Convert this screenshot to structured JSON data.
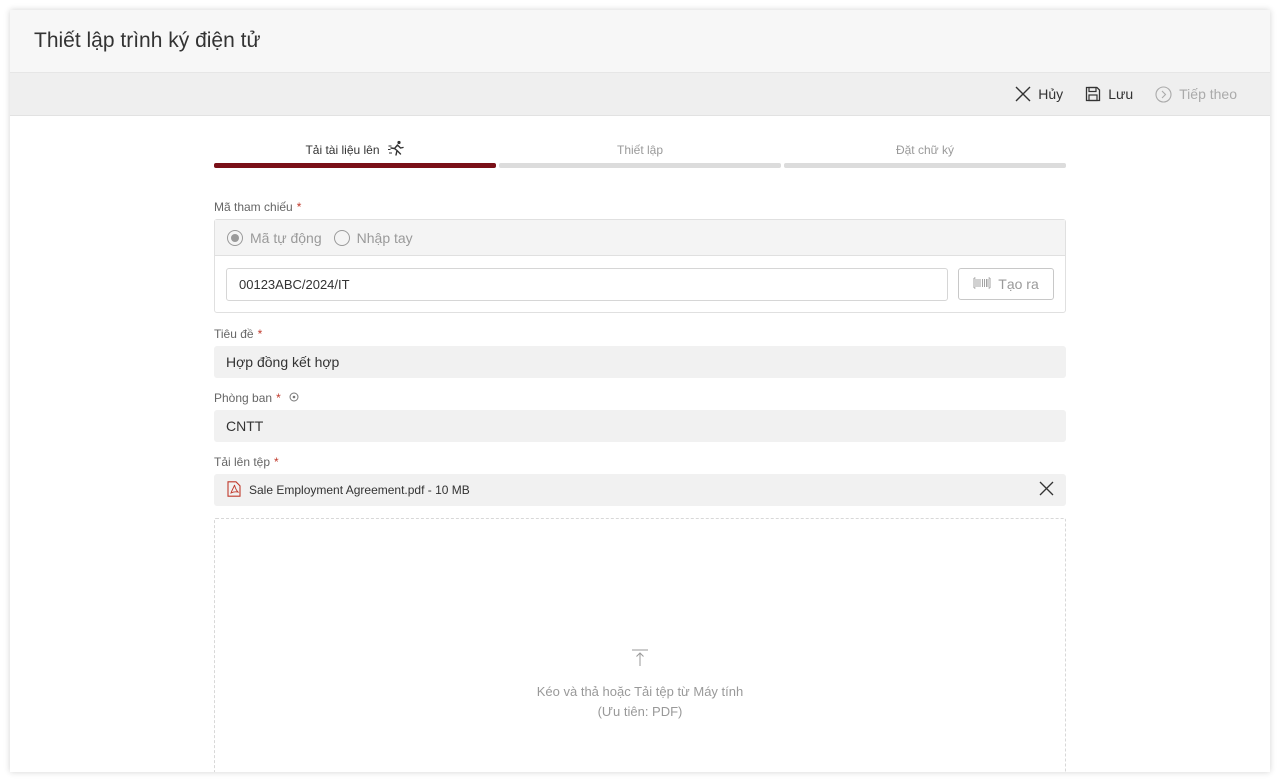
{
  "window": {
    "title": "Thiết lập trình ký điện tử"
  },
  "toolbar": {
    "cancel_label": "Hủy",
    "save_label": "Lưu",
    "next_label": "Tiếp theo"
  },
  "steps": [
    {
      "label": "Tải tài liệu lên",
      "state": "active"
    },
    {
      "label": "Thiết lập",
      "state": "inactive"
    },
    {
      "label": "Đặt chữ ký",
      "state": "inactive"
    }
  ],
  "reference": {
    "label": "Mã tham chiếu",
    "required_mark": "*",
    "option_auto": "Mã tự động",
    "option_manual": "Nhập tay",
    "value": "00123ABC/2024/IT",
    "generate_label": "Tạo ra"
  },
  "title_field": {
    "label": "Tiêu đề",
    "required_mark": "*",
    "value": "Hợp đồng kết hợp"
  },
  "department": {
    "label": "Phòng ban",
    "required_mark": "*",
    "value": "CNTT"
  },
  "upload": {
    "label": "Tải lên tệp",
    "required_mark": "*",
    "file_name": "Sale Employment Agreement.pdf - 10 MB",
    "dropzone_line1": "Kéo và thả hoặc Tải tệp từ Máy tính",
    "dropzone_line2": "(Ưu tiên: PDF)"
  },
  "colors": {
    "accent": "#7a1018",
    "required": "#c0392b",
    "pdf_icon": "#c0392b"
  }
}
